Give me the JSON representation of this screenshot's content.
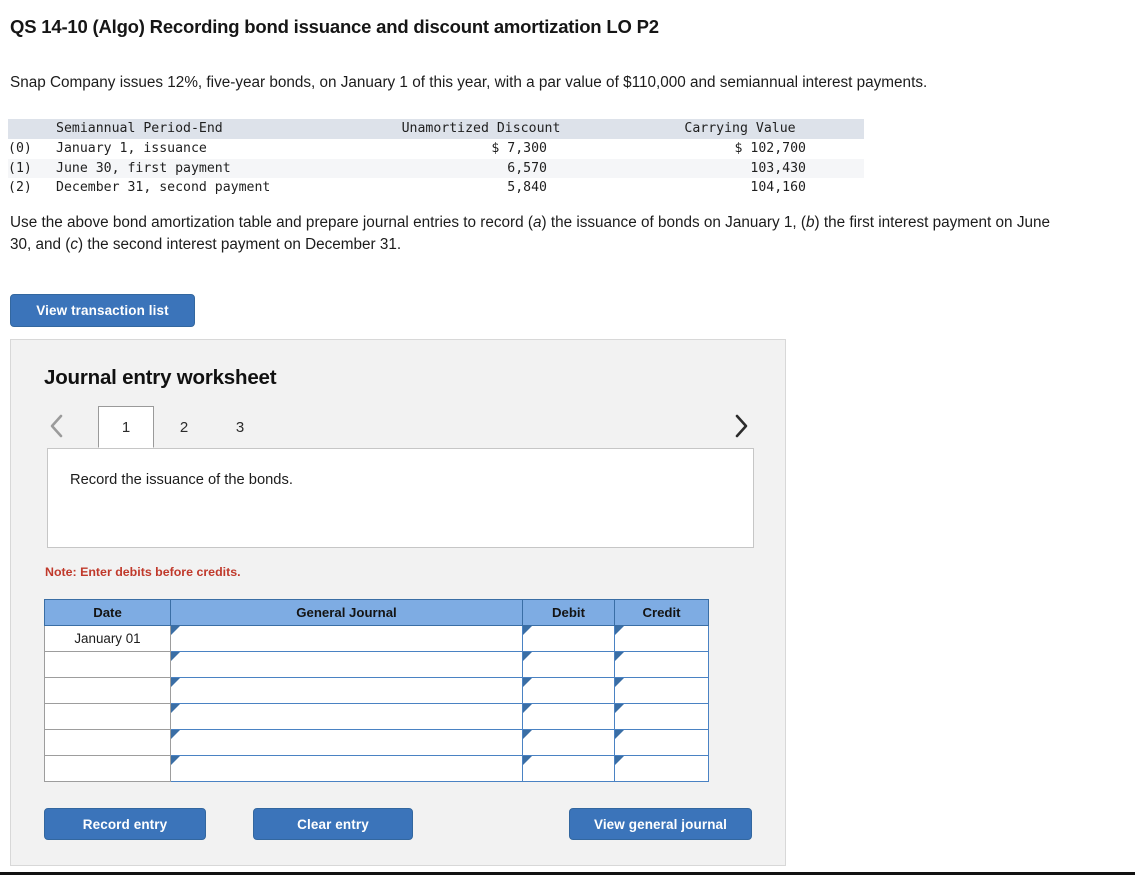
{
  "question": {
    "title": "QS 14-10 (Algo) Recording bond issuance and discount amortization LO P2",
    "intro": "Snap Company issues 12%, five-year bonds, on January 1 of this year, with a par value of $110,000 and semiannual interest payments.",
    "instruction_parts": {
      "p1": "Use the above bond amortization table and prepare journal entries to record (",
      "a": "a",
      "p2": ") the issuance of bonds on January 1, (",
      "b": "b",
      "p3": ") the first interest payment on June 30, and (",
      "c": "c",
      "p4": ") the second interest payment on December 31."
    }
  },
  "amortization_table": {
    "headers": {
      "index": "",
      "period_end": "Semiannual Period-End",
      "unamortized_discount": "Unamortized Discount",
      "carrying_value": "Carrying Value"
    },
    "rows": [
      {
        "index": "(0)",
        "period_end": "January 1, issuance",
        "unamortized_discount": "$ 7,300",
        "carrying_value": "$ 102,700"
      },
      {
        "index": "(1)",
        "period_end": "June 30, first payment",
        "unamortized_discount": "6,570",
        "carrying_value": "103,430"
      },
      {
        "index": "(2)",
        "period_end": "December 31, second payment",
        "unamortized_discount": "5,840",
        "carrying_value": "104,160"
      }
    ]
  },
  "buttons": {
    "view_transaction_list": "View transaction list",
    "record_entry": "Record entry",
    "clear_entry": "Clear entry",
    "view_general_journal": "View general journal"
  },
  "worksheet": {
    "title": "Journal entry worksheet",
    "tabs": [
      {
        "label": "1",
        "active": true
      },
      {
        "label": "2",
        "active": false
      },
      {
        "label": "3",
        "active": false
      }
    ],
    "nav": {
      "prev_icon": "chevron-left-icon",
      "next_icon": "chevron-right-icon"
    },
    "requirement_text": "Record the issuance of the bonds.",
    "note": "Note: Enter debits before credits.",
    "journal_table": {
      "headers": [
        "Date",
        "General Journal",
        "Debit",
        "Credit"
      ],
      "rows": [
        {
          "date": "January 01",
          "general_journal": "",
          "debit": "",
          "credit": ""
        },
        {
          "date": "",
          "general_journal": "",
          "debit": "",
          "credit": ""
        },
        {
          "date": "",
          "general_journal": "",
          "debit": "",
          "credit": ""
        },
        {
          "date": "",
          "general_journal": "",
          "debit": "",
          "credit": ""
        },
        {
          "date": "",
          "general_journal": "",
          "debit": "",
          "credit": ""
        },
        {
          "date": "",
          "general_journal": "",
          "debit": "",
          "credit": ""
        }
      ]
    }
  },
  "colors": {
    "button_blue": "#3b74ba",
    "table_header_blue": "#7eace3",
    "note_red": "#c0392b",
    "panel_gray": "#f2f2f2",
    "amort_header": "#dde2ea"
  }
}
